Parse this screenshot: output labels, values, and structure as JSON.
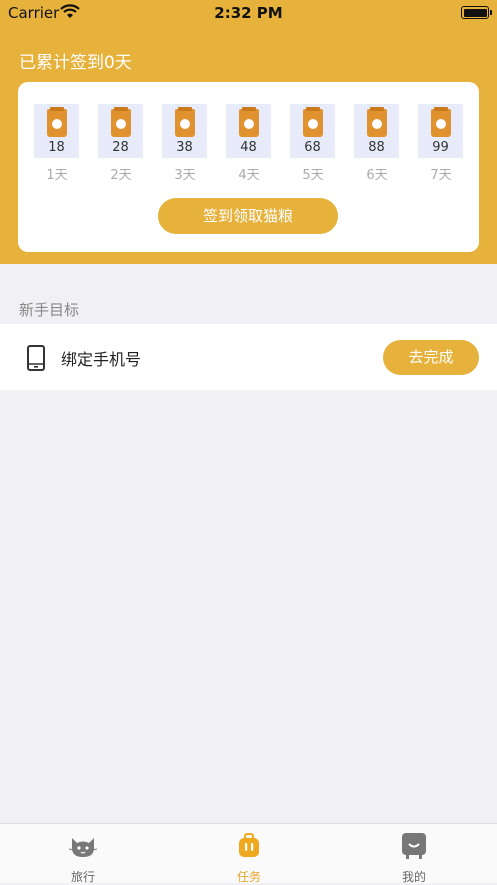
{
  "status": {
    "carrier": "Carrier",
    "time": "2:32 PM"
  },
  "header": {
    "title": "已累计签到0天"
  },
  "checkin": {
    "days": [
      {
        "value": "18",
        "label": "1天"
      },
      {
        "value": "28",
        "label": "2天"
      },
      {
        "value": "38",
        "label": "3天"
      },
      {
        "value": "48",
        "label": "4天"
      },
      {
        "value": "68",
        "label": "5天"
      },
      {
        "value": "88",
        "label": "6天"
      },
      {
        "value": "99",
        "label": "7天"
      }
    ],
    "button_label": "签到领取猫粮"
  },
  "section": {
    "title": "新手目标"
  },
  "task": {
    "label": "绑定手机号",
    "button_label": "去完成",
    "icon": "phone-icon"
  },
  "tabs": [
    {
      "label": "旅行",
      "icon": "cat-icon",
      "active": false
    },
    {
      "label": "任务",
      "icon": "suitcase-icon",
      "active": true
    },
    {
      "label": "我的",
      "icon": "smile-box-icon",
      "active": false
    }
  ],
  "colors": {
    "accent": "#e6b23c",
    "background": "#f0f0f5",
    "day_box": "#e7ebfa"
  }
}
